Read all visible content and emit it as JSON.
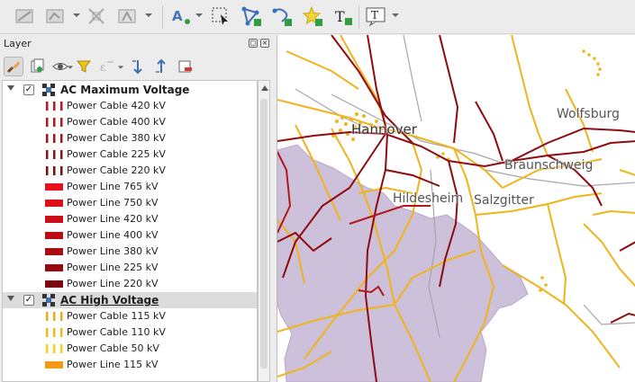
{
  "panel": {
    "title": "Layer"
  },
  "toolbar": {
    "icons": [
      "digitize-icon",
      "vertex-tool-icon",
      "move-feature-icon",
      "reshape-icon",
      "label-icon",
      "select-label-icon",
      "node-edit-icon",
      "add-node-icon",
      "star-icon",
      "text-annotation-icon",
      "text-tool-icon"
    ]
  },
  "layers": {
    "group1": {
      "label": "AC Maximum Voltage",
      "checked": true,
      "items": [
        {
          "label": "Power Cable 420 kV",
          "color": "#c1121f",
          "style": "dashed"
        },
        {
          "label": "Power Cable 400 kV",
          "color": "#b4161b",
          "style": "dashed"
        },
        {
          "label": "Power Cable 380 kV",
          "color": "#a8141a",
          "style": "dashed"
        },
        {
          "label": "Power Cable 225 kV",
          "color": "#951217",
          "style": "dashed"
        },
        {
          "label": "Power Cable 220 kV",
          "color": "#7f0e12",
          "style": "dashed"
        },
        {
          "label": "Power Line 765 kV",
          "color": "#e8101a",
          "style": "solid"
        },
        {
          "label": "Power Line 750 kV",
          "color": "#dc1018",
          "style": "solid"
        },
        {
          "label": "Power Line 420 kV",
          "color": "#cc0f16",
          "style": "solid"
        },
        {
          "label": "Power Line 400 kV",
          "color": "#bd0d14",
          "style": "solid"
        },
        {
          "label": "Power Line 380 kV",
          "color": "#a90c12",
          "style": "solid"
        },
        {
          "label": "Power Line 225 kV",
          "color": "#930a10",
          "style": "solid"
        },
        {
          "label": "Power Line 220 kV",
          "color": "#7a080c",
          "style": "solid"
        }
      ]
    },
    "group2": {
      "label": "AC High Voltage",
      "checked": true,
      "items": [
        {
          "label": "Power Cable 115 kV",
          "color": "#f0a81a",
          "style": "dashed"
        },
        {
          "label": "Power Cable 110 kV",
          "color": "#f2b81c",
          "style": "dashed"
        },
        {
          "label": "Power Cable 50 kV",
          "color": "#f4d020",
          "style": "dashed"
        },
        {
          "label": "Power Line 115 kV",
          "color": "#f29b12",
          "style": "solid"
        }
      ]
    }
  },
  "map": {
    "places": {
      "hannover": "Hannover",
      "wolfsburg": "Wolfsburg",
      "braunschweig": "Braunschweig",
      "hildesheim": "Hildesheim",
      "salzgitter": "Salzgitter"
    }
  }
}
